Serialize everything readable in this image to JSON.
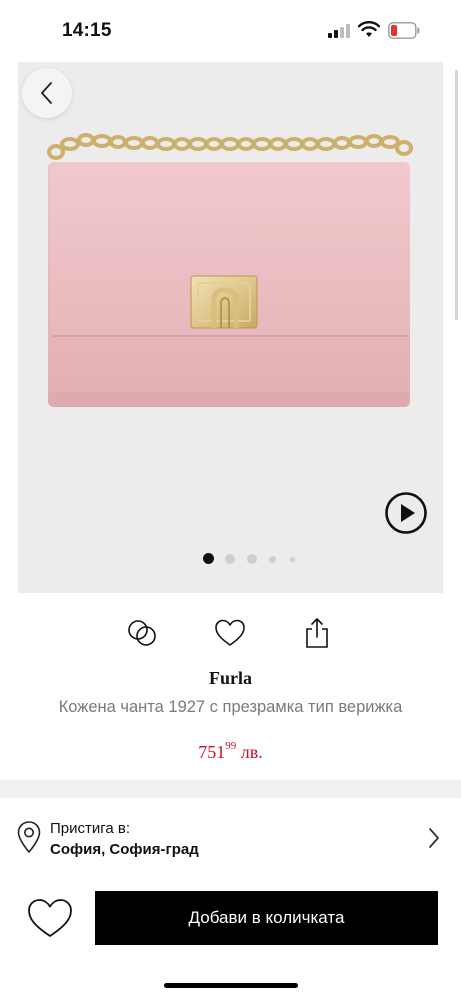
{
  "status_bar": {
    "time": "14:15"
  },
  "product": {
    "brand": "Furla",
    "title": "Кожена чанта 1927 с презрамка тип верижка",
    "price_main": "751",
    "price_cents": "99",
    "price_currency": " лв."
  },
  "gallery": {
    "active_dot": 1,
    "dot_count": 5
  },
  "availability": {
    "label": "Пристига в:",
    "city": "София, София-град"
  },
  "cart": {
    "button_label": "Добави в количката"
  },
  "colors": {
    "accent_price": "#c8102e",
    "button_bg": "#000000",
    "bag_pink": "#e9bcc0"
  }
}
